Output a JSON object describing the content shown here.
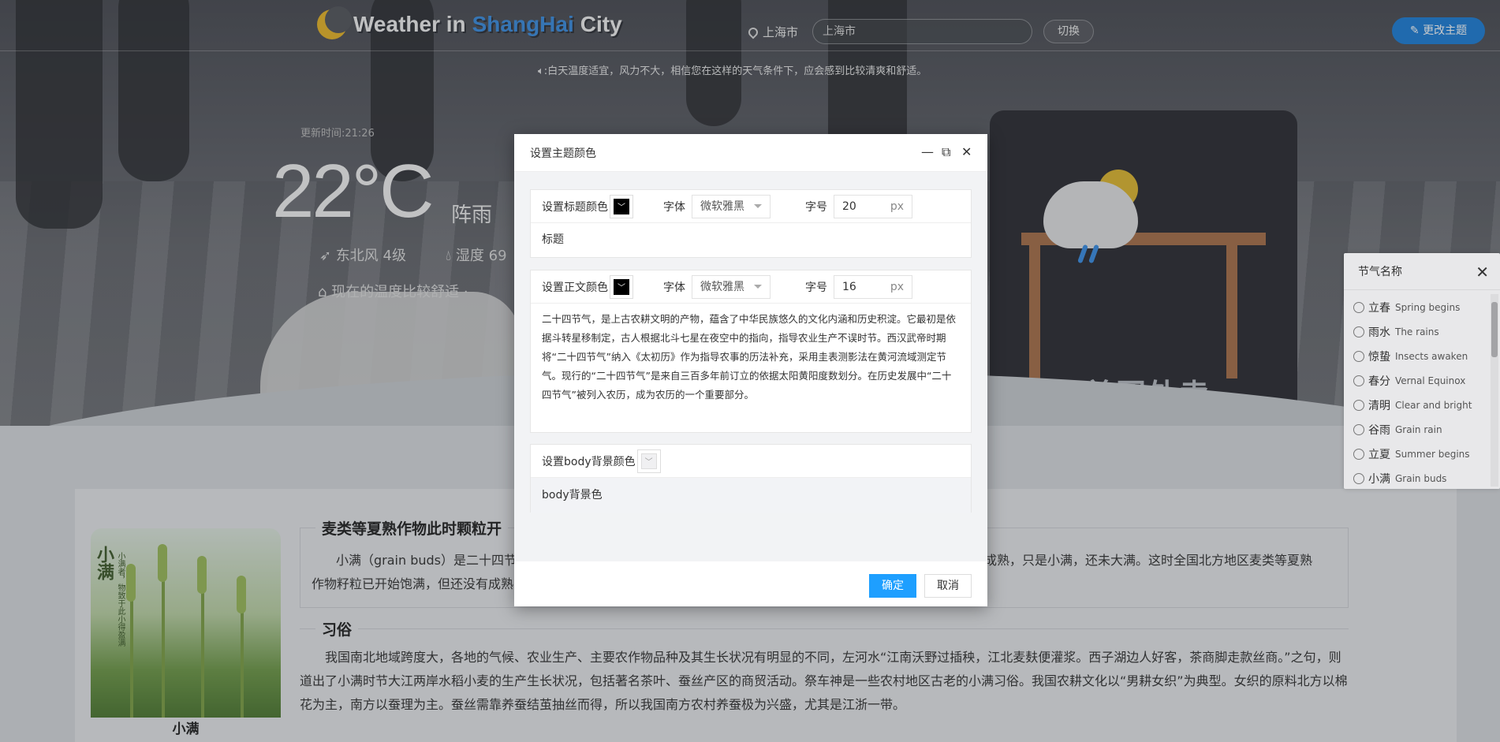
{
  "header": {
    "logo_text_1": "Weather in",
    "logo_text_2": "ShangHai",
    "logo_text_3": "City",
    "location_label": "上海市",
    "search_value": "上海市",
    "switch_label": "切换",
    "theme_button_label": "更改主题",
    "notice": "白天温度适宜，风力不大，相信您在这样的天气条件下，应会感到比较清爽和舒适。"
  },
  "weather": {
    "update_time": "更新时间:21:26",
    "temperature": "22°C",
    "condition": "阵雨",
    "wind": "东北风 4级",
    "humidity": "湿度 69",
    "tip": "现在的温度比较舒适 ·"
  },
  "content": {
    "image_caption": "小满",
    "image_vertical_title": "小满",
    "image_vertical_sub": "小满者，物致于此小得盈满",
    "section1_title": "麦类等夏熟作物此时颗粒开",
    "section1_line1_left": "小满（grain buds）是二十四节",
    "section1_line1_right": "未成熟，只是小满，还未大满。这时全国北方地区麦类等夏熟",
    "section1_line2_left": "作物籽粒已开始饱满，但还没有成熟",
    "section2_title": "习俗",
    "section2_text": "我国南北地域跨度大，各地的气候、农业生产、主要农作物品种及其生长状况有明显的不同，左河水“江南沃野过插秧，江北麦麸便灌浆。西子湖边人好客，茶商脚走款丝商。”之句，则道出了小满时节大江两岸水稻小麦的生产生长状况，包括著名茶叶、蚕丝产区的商贸活动。祭车神是一些农村地区古老的小满习俗。我国农耕文化以“男耕女织”为典型。女织的原料北方以棉花为主，南方以蚕理为主。蚕丝需靠养蚕结茧抽丝而得，所以我国南方农村养蚕极为兴盛，尤其是江浙一带。"
  },
  "terms_panel": {
    "title": "节气名称",
    "items": [
      {
        "cn": "立春",
        "en": "Spring begins"
      },
      {
        "cn": "雨水",
        "en": "The rains"
      },
      {
        "cn": "惊蛰",
        "en": "Insects awaken"
      },
      {
        "cn": "春分",
        "en": "Vernal Equinox"
      },
      {
        "cn": "清明",
        "en": "Clear and bright"
      },
      {
        "cn": "谷雨",
        "en": "Grain rain"
      },
      {
        "cn": "立夏",
        "en": "Summer begins"
      },
      {
        "cn": "小满",
        "en": "Grain buds"
      }
    ]
  },
  "modal": {
    "title": "设置主题颜色",
    "title_group": {
      "color_label": "设置标题颜色",
      "font_label": "字体",
      "font_value": "微软雅黑",
      "size_label": "字号",
      "size_value": "20",
      "size_unit": "px",
      "preview": "标题"
    },
    "body_group": {
      "color_label": "设置正文颜色",
      "font_label": "字体",
      "font_value": "微软雅黑",
      "size_label": "字号",
      "size_value": "16",
      "size_unit": "px",
      "preview": "二十四节气，是上古农耕文明的产物，蕴含了中华民族悠久的文化内涵和历史积淀。它最初是依据斗转星移制定，古人根据北斗七星在夜空中的指向，指导农业生产不误时节。西汉武帝时期将“二十四节气”纳入《太初历》作为指导农事的历法补充，采用圭表测影法在黄河流域测定节气。现行的“二十四节气”是来自三百多年前订立的依据太阳黄阳度数划分。在历史发展中“二十四节气”被列入农历，成为农历的一个重要部分。"
    },
    "bg_group": {
      "color_label": "设置body背景颜色",
      "preview": "body背景色"
    },
    "confirm_label": "确定",
    "cancel_label": "取消"
  },
  "colors": {
    "accent": "#1e9fff",
    "theme_button": "#1e7fd8",
    "logo_blue": "#3b8ee0",
    "moon": "#e9b628"
  }
}
